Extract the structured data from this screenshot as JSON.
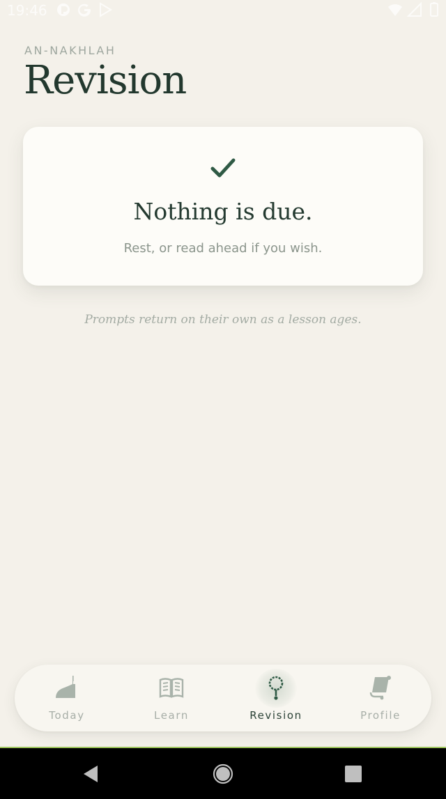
{
  "status_bar": {
    "time": "19:46",
    "left_icons": [
      "app-icon",
      "google-icon",
      "play-icon"
    ],
    "right_icons": [
      "wifi-icon",
      "signal-icon",
      "battery-icon"
    ]
  },
  "header": {
    "brand": "AN-NAKHLAH",
    "title": "Revision"
  },
  "card": {
    "icon": "check-icon",
    "title": "Nothing is due.",
    "subtitle": "Rest, or read ahead if you wish."
  },
  "note": "Prompts return on their own as a lesson ages.",
  "tabs": [
    {
      "label": "Today",
      "icon": "mosque-icon",
      "active": false
    },
    {
      "label": "Learn",
      "icon": "book-icon",
      "active": false
    },
    {
      "label": "Revision",
      "icon": "prayer-beads-icon",
      "active": true
    },
    {
      "label": "Profile",
      "icon": "scroll-icon",
      "active": false
    }
  ],
  "colors": {
    "background": "#f4f1ea",
    "card": "#fdfcf8",
    "accent": "#2f5a45",
    "title": "#22382e",
    "muted": "#a7aea7"
  },
  "system_nav": [
    "back-icon",
    "home-icon",
    "recents-icon"
  ]
}
